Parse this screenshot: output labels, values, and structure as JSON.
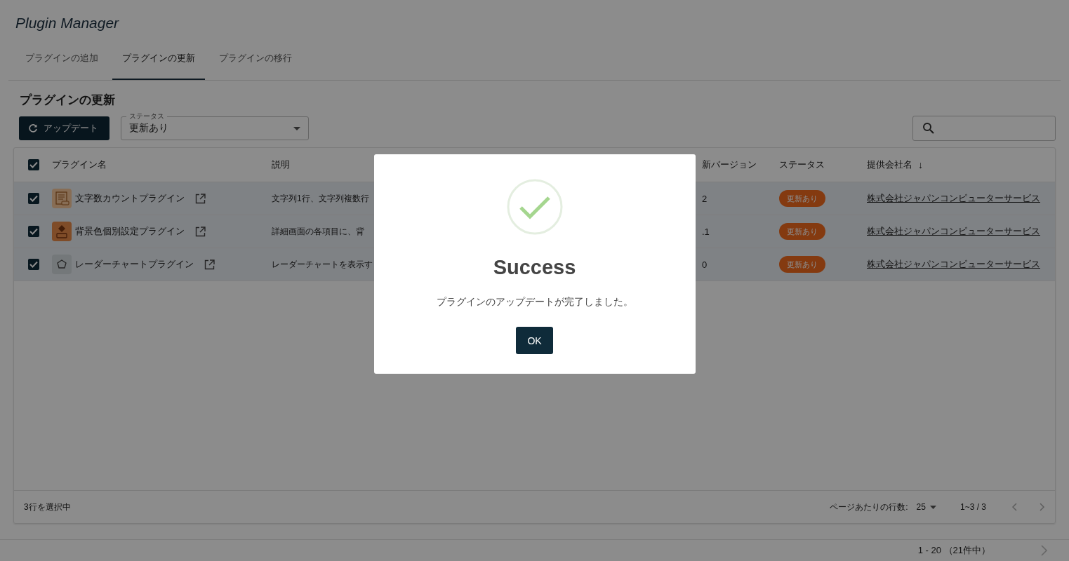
{
  "app_title": "Plugin Manager",
  "tabs": [
    {
      "label": "プラグインの追加",
      "selected": false
    },
    {
      "label": "プラグインの更新",
      "selected": true
    },
    {
      "label": "プラグインの移行",
      "selected": false
    }
  ],
  "section_title": "プラグインの更新",
  "update_button": "アップデート",
  "status_filter": {
    "label": "ステータス",
    "value": "更新あり"
  },
  "table": {
    "all_checked": true,
    "columns": [
      {
        "label": "プラグイン名"
      },
      {
        "label": "説明"
      },
      {
        "label": "新バージョン"
      },
      {
        "label": "ステータス"
      },
      {
        "label": "提供会社名",
        "sort_mark": "↓"
      }
    ],
    "rows": [
      {
        "checked": true,
        "name": "文字数カウントプラグイン",
        "description": "文字列1行、文字列複数行",
        "version": "2",
        "status": "更新あり",
        "company": "株式会社ジャパンコンピューターサービス"
      },
      {
        "checked": true,
        "name": "背景色個別設定プラグイン",
        "description": "詳細画面の各項目に、背",
        "version": ".1",
        "status": "更新あり",
        "company": "株式会社ジャパンコンピューターサービス"
      },
      {
        "checked": true,
        "name": "レーダーチャートプラグイン",
        "description": "レーダーチャートを表示す",
        "version": "0",
        "status": "更新あり",
        "company": "株式会社ジャパンコンピューターサービス"
      }
    ],
    "footer": {
      "selected_count": "3行を選択中",
      "rows_per_page_label": "ページあたりの行数:",
      "rows_per_page": "25",
      "range": "1~3 / 3"
    }
  },
  "pagination": "1 - 20 （21件中）",
  "dialog": {
    "title": "Success",
    "message": "プラグインのアップデートが完了しました。",
    "button": "OK"
  }
}
